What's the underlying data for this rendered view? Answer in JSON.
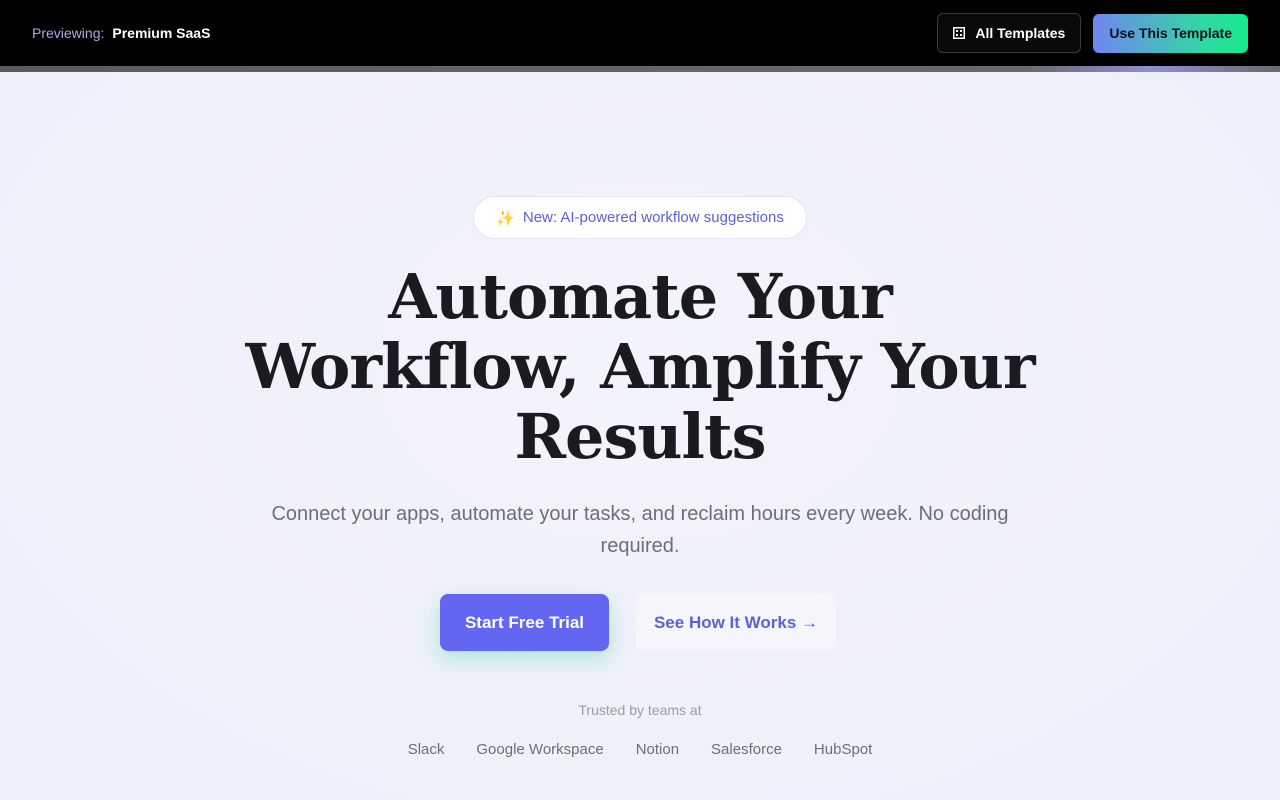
{
  "topbar": {
    "preview_label": "Previewing:",
    "template_name": "Premium SaaS",
    "all_templates_label": "All Templates",
    "use_template_label": "Use This Template",
    "all_templates_icon": "grid-icon"
  },
  "hero": {
    "badge_icon": "✨",
    "badge_text": "New: AI-powered workflow suggestions",
    "headline_lines": [
      "Automate Your",
      "Workflow, Amplify Your",
      "Results"
    ],
    "subtext": "Connect your apps, automate your tasks, and reclaim hours every week. No coding required.",
    "cta_primary": "Start Free Trial",
    "cta_secondary": "See How It Works →",
    "trusted_label": "Trusted by teams at",
    "logos": [
      "Slack",
      "Google Workspace",
      "Notion",
      "Salesforce",
      "HubSpot"
    ]
  },
  "colors": {
    "accent": "#6366f1",
    "topbar_bg": "#000000",
    "gradient_start": "#6f86f0",
    "gradient_end": "#14ea8c"
  }
}
